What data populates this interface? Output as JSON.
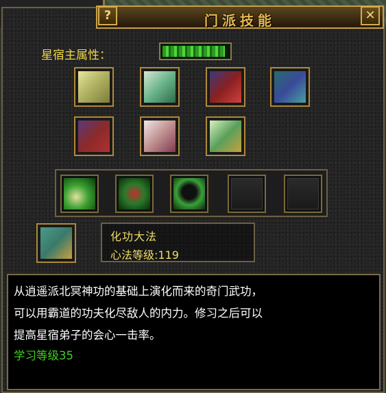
{
  "window": {
    "title": "门派技能",
    "help_label": "?",
    "close_label": "✕"
  },
  "attribute": {
    "label": "星宿主属性：",
    "fill_fraction": 0.95,
    "color": "#51d43a"
  },
  "books": [
    {
      "icon": "scroll-book-icon"
    },
    {
      "icon": "scroll-book-icon"
    },
    {
      "icon": "tied-books-icon"
    },
    {
      "icon": "blue-book-icon"
    },
    {
      "icon": "purple-book-icon"
    },
    {
      "icon": "pink-book-icon"
    },
    {
      "icon": "green-book-icon"
    }
  ],
  "skills": [
    {
      "icon": "palm-strike-icon"
    },
    {
      "icon": "red-figure-icon"
    },
    {
      "icon": "dark-figure-icon"
    },
    {
      "icon": "empty-slot-icon"
    },
    {
      "icon": "empty-slot-icon"
    }
  ],
  "selected": {
    "name": "化功大法",
    "level_text": "心法等级:119"
  },
  "description": {
    "line1": "从逍遥派北冥神功的基础上演化而来的奇门武功，",
    "line2": "可以用霸道的功夫化尽敌人的内力。修习之后可以",
    "line3": "提高星宿弟子的会心一击率。",
    "learn_level": "学习等级35"
  }
}
